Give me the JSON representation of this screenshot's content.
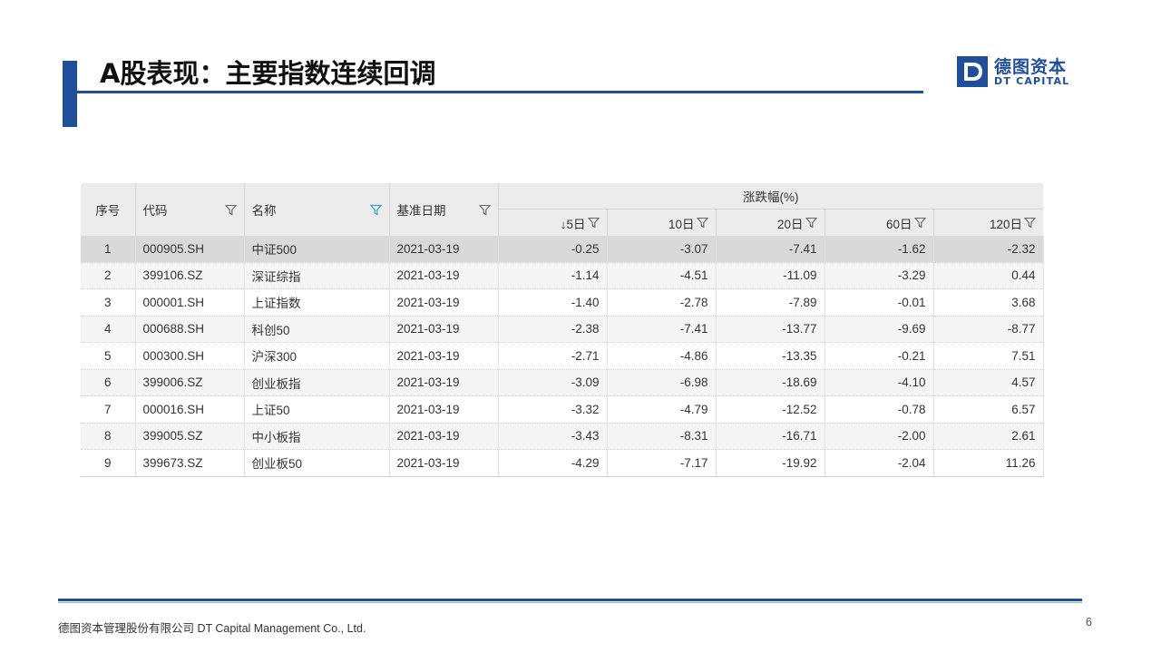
{
  "slide": {
    "title": "A股表现：主要指数连续回调",
    "page_number": "6",
    "footer": "德图资本管理股份有限公司  DT Capital  Management  Co., Ltd."
  },
  "logo": {
    "cn": "德图资本",
    "en": "DT CAPITAL"
  },
  "colors": {
    "brand_blue": "#1f4e9b",
    "filter_active": "#3aa0c8"
  },
  "table": {
    "headers": {
      "seq": "序号",
      "code": "代码",
      "name": "名称",
      "base_date": "基准日期",
      "change_group": "涨跌幅(%)",
      "d5": "↓5日",
      "d10": "10日",
      "d20": "20日",
      "d60": "60日",
      "d120": "120日"
    },
    "rows": [
      {
        "seq": "1",
        "code": "000905.SH",
        "name": "中证500",
        "date": "2021-03-19",
        "d5": "-0.25",
        "d10": "-3.07",
        "d20": "-7.41",
        "d60": "-1.62",
        "d120": "-2.32"
      },
      {
        "seq": "2",
        "code": "399106.SZ",
        "name": "深证综指",
        "date": "2021-03-19",
        "d5": "-1.14",
        "d10": "-4.51",
        "d20": "-11.09",
        "d60": "-3.29",
        "d120": "0.44"
      },
      {
        "seq": "3",
        "code": "000001.SH",
        "name": "上证指数",
        "date": "2021-03-19",
        "d5": "-1.40",
        "d10": "-2.78",
        "d20": "-7.89",
        "d60": "-0.01",
        "d120": "3.68"
      },
      {
        "seq": "4",
        "code": "000688.SH",
        "name": "科创50",
        "date": "2021-03-19",
        "d5": "-2.38",
        "d10": "-7.41",
        "d20": "-13.77",
        "d60": "-9.69",
        "d120": "-8.77"
      },
      {
        "seq": "5",
        "code": "000300.SH",
        "name": "沪深300",
        "date": "2021-03-19",
        "d5": "-2.71",
        "d10": "-4.86",
        "d20": "-13.35",
        "d60": "-0.21",
        "d120": "7.51"
      },
      {
        "seq": "6",
        "code": "399006.SZ",
        "name": "创业板指",
        "date": "2021-03-19",
        "d5": "-3.09",
        "d10": "-6.98",
        "d20": "-18.69",
        "d60": "-4.10",
        "d120": "4.57"
      },
      {
        "seq": "7",
        "code": "000016.SH",
        "name": "上证50",
        "date": "2021-03-19",
        "d5": "-3.32",
        "d10": "-4.79",
        "d20": "-12.52",
        "d60": "-0.78",
        "d120": "6.57"
      },
      {
        "seq": "8",
        "code": "399005.SZ",
        "name": "中小板指",
        "date": "2021-03-19",
        "d5": "-3.43",
        "d10": "-8.31",
        "d20": "-16.71",
        "d60": "-2.00",
        "d120": "2.61"
      },
      {
        "seq": "9",
        "code": "399673.SZ",
        "name": "创业板50",
        "date": "2021-03-19",
        "d5": "-4.29",
        "d10": "-7.17",
        "d20": "-19.92",
        "d60": "-2.04",
        "d120": "11.26"
      }
    ]
  }
}
